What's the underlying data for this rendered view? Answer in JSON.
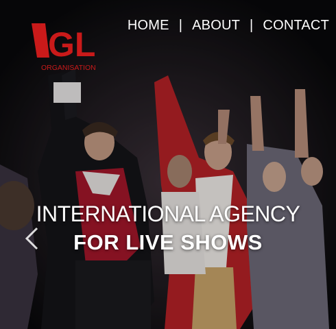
{
  "brand": {
    "logo_letters": "GL",
    "logo_sub": "ORGANISATION",
    "logo_color": "#c91a1a"
  },
  "nav": {
    "items": [
      {
        "label": "HOME"
      },
      {
        "label": "ABOUT"
      },
      {
        "label": "CONTACT"
      }
    ],
    "separator": "|"
  },
  "hero": {
    "line1": "INTERNATIONAL AGENCY",
    "line2": "FOR LIVE SHOWS",
    "prev_icon": "chevron-left-icon"
  },
  "colors": {
    "accent_red": "#c91a1a",
    "text": "#ffffff"
  }
}
